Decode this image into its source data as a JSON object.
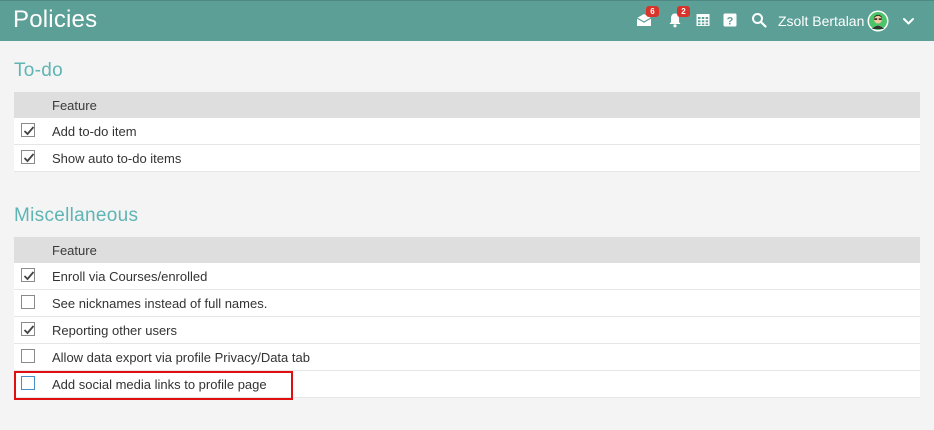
{
  "header": {
    "title": "Policies",
    "user_name": "Zsolt Bertalan",
    "icons": [
      {
        "name": "messages-icon",
        "badge": "6"
      },
      {
        "name": "notifications-icon",
        "badge": "2"
      },
      {
        "name": "calendar-icon",
        "badge": ""
      },
      {
        "name": "help-icon",
        "badge": ""
      },
      {
        "name": "search-icon",
        "badge": ""
      }
    ],
    "colors": {
      "bar": "#5b9f97",
      "badge": "#d9342b"
    }
  },
  "sections": [
    {
      "title": "To-do",
      "column_header": "Feature",
      "rows": [
        {
          "label": "Add to-do item",
          "checked": true
        },
        {
          "label": "Show auto to-do items",
          "checked": true
        }
      ]
    },
    {
      "title": "Miscellaneous",
      "column_header": "Feature",
      "rows": [
        {
          "label": "Enroll via Courses/enrolled",
          "checked": true
        },
        {
          "label": "See nicknames instead of full names.",
          "checked": false
        },
        {
          "label": "Reporting other users",
          "checked": true
        },
        {
          "label": "Allow data export via profile Privacy/Data tab",
          "checked": false
        },
        {
          "label": "Add social media links to profile page",
          "checked": false
        }
      ]
    }
  ],
  "accent_color": "#5fb4b4",
  "highlight_color": "#e01010"
}
